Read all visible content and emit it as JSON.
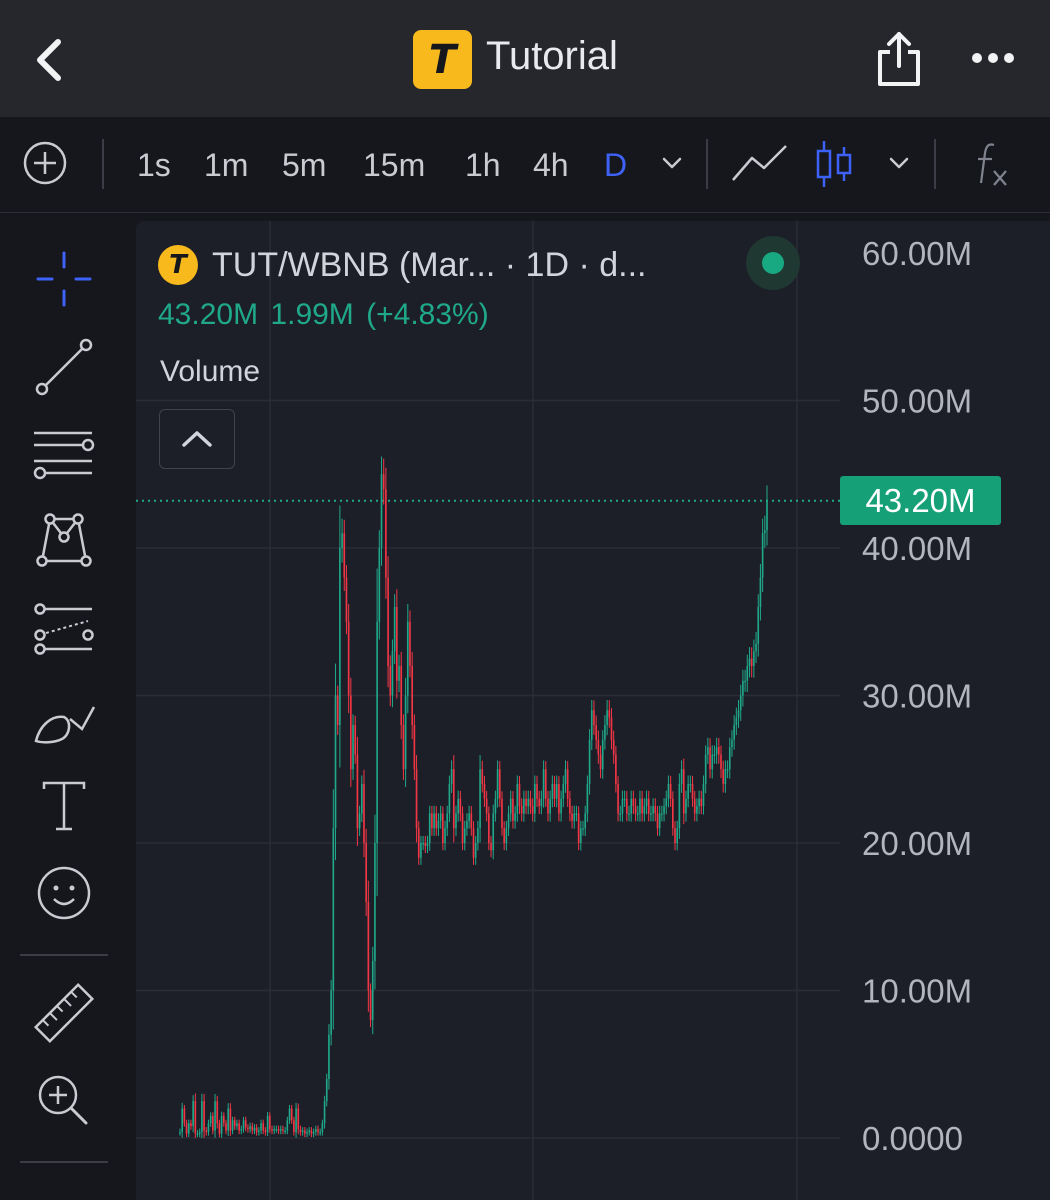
{
  "header": {
    "title": "Tutorial",
    "logo_letter": "T"
  },
  "toolbar": {
    "intervals": [
      "1s",
      "1m",
      "5m",
      "15m",
      "1h",
      "4h",
      "D"
    ],
    "active_interval": "D"
  },
  "symbol": {
    "legend": "TUT/WBNB (Mar...  · 1D · d...",
    "close": "43.20M",
    "change": "1.99M",
    "change_pct": "(+4.83%)",
    "volume_label": "Volume",
    "status": "market-open"
  },
  "colors": {
    "up": "#1fa889",
    "down": "#f23645",
    "accent": "#3d62f5",
    "brand": "#f7b91c",
    "price_tag": "#15a078"
  },
  "chart_data": {
    "type": "candlestick",
    "y_tick_labels": [
      "60.00M",
      "50.00M",
      "40.00M",
      "30.00M",
      "20.00M",
      "10.00M",
      "0.0000"
    ],
    "ylim": [
      0,
      60
    ],
    "y_unit": "M",
    "last_price_label": "43.20M",
    "last_price": 43.2,
    "grid": true,
    "closes": [
      0.4,
      2,
      1,
      0.3,
      1,
      0.8,
      2.5,
      0.3,
      0.3,
      0.4,
      2.5,
      0.5,
      0.4,
      1,
      1.5,
      0.5,
      2.5,
      1,
      0.3,
      1.5,
      1,
      0.5,
      2,
      0.5,
      1.2,
      0.8,
      1,
      0.5,
      0.6,
      1.2,
      0.7,
      0.6,
      0.8,
      0.5,
      0.7,
      0.4,
      0.5,
      1,
      0.5,
      0.4,
      1.5,
      0.6,
      0.5,
      0.6,
      0.6,
      0.5,
      0.6,
      0.5,
      0.5,
      1.2,
      2,
      1.2,
      0.4,
      2,
      0.6,
      0.4,
      0.5,
      0.3,
      0.4,
      0.5,
      0.3,
      0.4,
      0.6,
      0.4,
      0.4,
      1,
      2.5,
      4,
      7,
      10,
      21,
      30,
      28,
      40,
      41,
      38,
      35,
      30,
      25,
      28,
      26,
      21,
      22,
      24,
      20,
      16,
      10,
      8,
      12,
      20,
      35,
      40,
      45,
      44,
      38,
      32,
      30,
      33,
      36,
      31,
      32,
      28,
      25,
      30,
      35,
      32,
      28,
      25,
      21,
      19,
      20,
      20,
      19.8,
      20,
      22,
      21,
      22,
      21,
      21.5,
      22,
      20,
      21,
      22,
      24,
      25,
      21,
      22,
      23,
      22,
      20,
      21,
      21.5,
      22,
      21,
      19,
      20,
      21,
      25,
      24,
      23,
      22,
      20,
      19.5,
      22,
      23,
      25,
      23,
      21,
      20,
      21,
      22,
      23,
      21.5,
      22,
      24,
      22.5,
      22,
      23,
      22.5,
      23,
      22.5,
      22,
      24,
      23,
      22.5,
      23,
      25,
      23,
      22,
      23,
      24,
      23,
      24,
      22,
      23,
      24,
      25,
      23,
      22,
      21.5,
      22,
      22,
      20,
      21,
      21,
      22,
      24,
      27,
      29,
      28,
      27,
      26,
      25,
      27,
      28,
      29,
      28.5,
      27,
      26,
      24,
      22,
      22,
      23,
      23,
      22,
      22,
      23,
      22.5,
      22,
      22,
      23,
      22,
      22.5,
      23,
      22,
      22,
      22.5,
      22,
      21,
      22,
      22,
      22.5,
      23,
      24,
      23,
      21,
      20,
      21,
      24,
      25,
      22,
      23,
      24,
      24,
      23,
      22,
      22.5,
      23,
      22.5,
      24,
      26,
      26.5,
      25,
      26,
      26,
      26.5,
      26,
      25,
      24,
      25,
      25,
      26.5,
      27,
      28,
      28.5,
      29,
      30,
      31,
      31,
      32,
      32.5,
      32,
      33,
      33.5,
      36,
      38,
      41,
      41.2,
      43.2
    ]
  }
}
